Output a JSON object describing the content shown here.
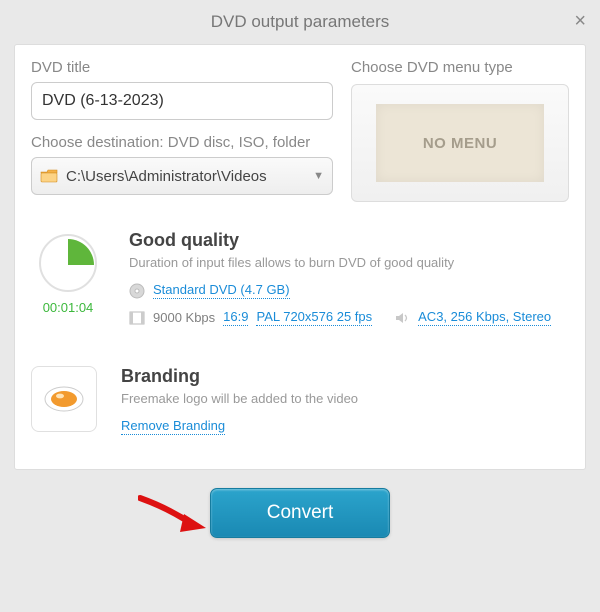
{
  "dialog": {
    "title": "DVD output parameters",
    "close_tooltip": "Close"
  },
  "dvd_title": {
    "label": "DVD title",
    "value": "DVD (6-13-2023)"
  },
  "destination": {
    "label": "Choose destination: DVD disc, ISO, folder",
    "value": "C:\\Users\\Administrator\\Videos"
  },
  "menu": {
    "label": "Choose DVD menu type",
    "preview_text": "NO MENU"
  },
  "quality": {
    "duration": "00:01:04",
    "title": "Good quality",
    "description": "Duration of input files allows to burn DVD of good quality",
    "media_spec": "Standard DVD (4.7 GB)",
    "bitrate": "9000 Kbps",
    "aspect": "16:9",
    "video_format": "PAL 720x576 25 fps",
    "audio_format": "AC3, 256 Kbps, Stereo"
  },
  "branding": {
    "title": "Branding",
    "description": "Freemake logo will be added to the video",
    "remove_link": "Remove Branding"
  },
  "convert": {
    "label": "Convert"
  }
}
